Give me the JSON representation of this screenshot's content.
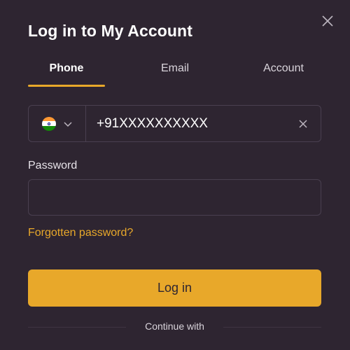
{
  "modal": {
    "title": "Log in to My Account"
  },
  "tabs": [
    {
      "label": "Phone",
      "active": true
    },
    {
      "label": "Email",
      "active": false
    },
    {
      "label": "Account",
      "active": false
    }
  ],
  "phone": {
    "country_flag": "india-flag-icon",
    "value": "+91XXXXXXXXXX"
  },
  "password": {
    "label": "Password",
    "value": ""
  },
  "links": {
    "forgot": "Forgotten password?"
  },
  "buttons": {
    "login": "Log in"
  },
  "footer": {
    "continue_with": "Continue with"
  },
  "colors": {
    "background": "#2e2531",
    "accent": "#e8a82a",
    "border": "#4a4050"
  }
}
